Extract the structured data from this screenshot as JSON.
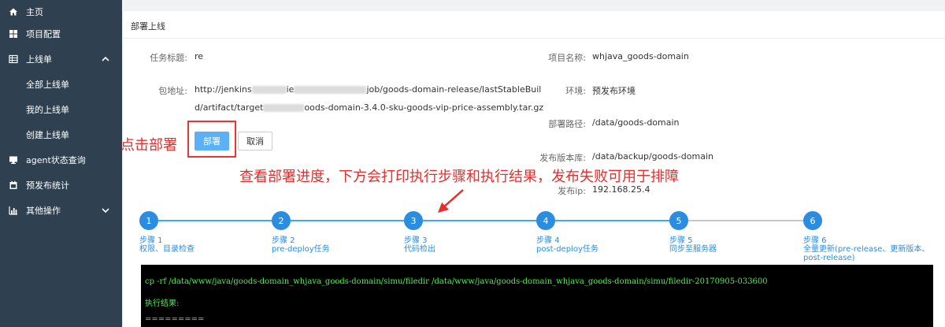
{
  "sidebar": {
    "items": [
      {
        "label": "主页",
        "icon": "home-icon"
      },
      {
        "label": "项目配置",
        "icon": "grid-icon"
      },
      {
        "label": "上线单",
        "icon": "table-icon"
      },
      {
        "label": "全部上线单"
      },
      {
        "label": "我的上线单"
      },
      {
        "label": "创建上线单"
      },
      {
        "label": "agent状态查询",
        "icon": "desktop-icon"
      },
      {
        "label": "预发布统计",
        "icon": "calendar-icon"
      },
      {
        "label": "其他操作",
        "icon": "bar-chart-icon"
      }
    ]
  },
  "panel": {
    "title": "部署上线",
    "fields": {
      "task_title": {
        "label": "任务标题:",
        "value": "re"
      },
      "package": {
        "label": "包地址:",
        "line1_a": "http://jenkins",
        "line1_b": "ie",
        "line1_c": "job/goods-domain-release/lastStableBuil",
        "line2_a": "d/artifact/target",
        "line2_b": "oods-domain-3.4.0-sku-goods-vip-price-assembly.tar.gz"
      },
      "project_name": {
        "label": "项目名称:",
        "value": "whjava_goods-domain"
      },
      "env": {
        "label": "环境:",
        "value": "预发布环境"
      },
      "deploy_path": {
        "label": "部署路径:",
        "value": "/data/goods-domain"
      },
      "release_lib": {
        "label": "发布版本库:",
        "value": "/data/backup/goods-domain"
      },
      "release_ip": {
        "label": "发布ip:",
        "value": "192.168.25.4"
      }
    },
    "buttons": {
      "deploy": "部署",
      "cancel": "取消"
    }
  },
  "annotations": {
    "click_deploy": "点击部署",
    "progress_note": "查看部署进度，下方会打印执行步骤和执行结果，发布失败可用于排障"
  },
  "steps": [
    {
      "num": "1",
      "title": "步骤 1",
      "desc": "权限、目录检查"
    },
    {
      "num": "2",
      "title": "步骤 2",
      "desc": "pre-deploy任务"
    },
    {
      "num": "3",
      "title": "步骤 3",
      "desc": "代码检出"
    },
    {
      "num": "4",
      "title": "步骤 4",
      "desc": "post-deploy任务"
    },
    {
      "num": "5",
      "title": "步骤 5",
      "desc": "同步至服务器"
    },
    {
      "num": "6",
      "title": "步骤 6",
      "desc": "全量更新(pre-release、更新版本、post-release)"
    }
  ],
  "console": {
    "lines": [
      "cp -rf /data/www/java/goods-domain_whjava_goods-domain/simu/filedir /data/www/java/goods-domain_whjava_goods-domain/simu/filedir-20170905-033600",
      "执行结果:",
      "========="
    ]
  },
  "colors": {
    "sidebar_bg": "#2f4050",
    "accent": "#2a8de0",
    "deploy_button": "#5bb0f6",
    "annotation": "#e82d2d",
    "console_text": "#47f547"
  }
}
